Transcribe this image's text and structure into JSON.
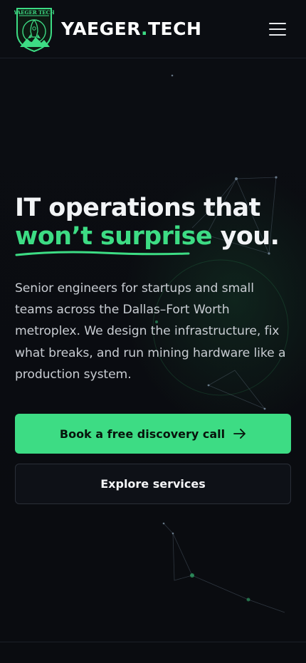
{
  "header": {
    "logo_text": "YAEGER TECH",
    "brand_main": "YAEGER",
    "brand_dot": ".",
    "brand_suffix": "TECH",
    "menu_icon": "hamburger-menu-icon"
  },
  "hero": {
    "headline_line1": "IT operations that",
    "headline_accent": "won’t surprise",
    "headline_end": " you.",
    "lede": "Senior engineers for startups and small teams across the Dallas–Fort Worth metroplex. We design the infrastructure, fix what breaks, and run mining hardware like a production system."
  },
  "actions": {
    "primary_label": "Book a free discovery call",
    "primary_icon": "arrow-right-icon",
    "secondary_label": "Explore services"
  },
  "colors": {
    "accent": "#3ddc84",
    "background": "#0a0c10",
    "text": "#e6e8eb"
  }
}
